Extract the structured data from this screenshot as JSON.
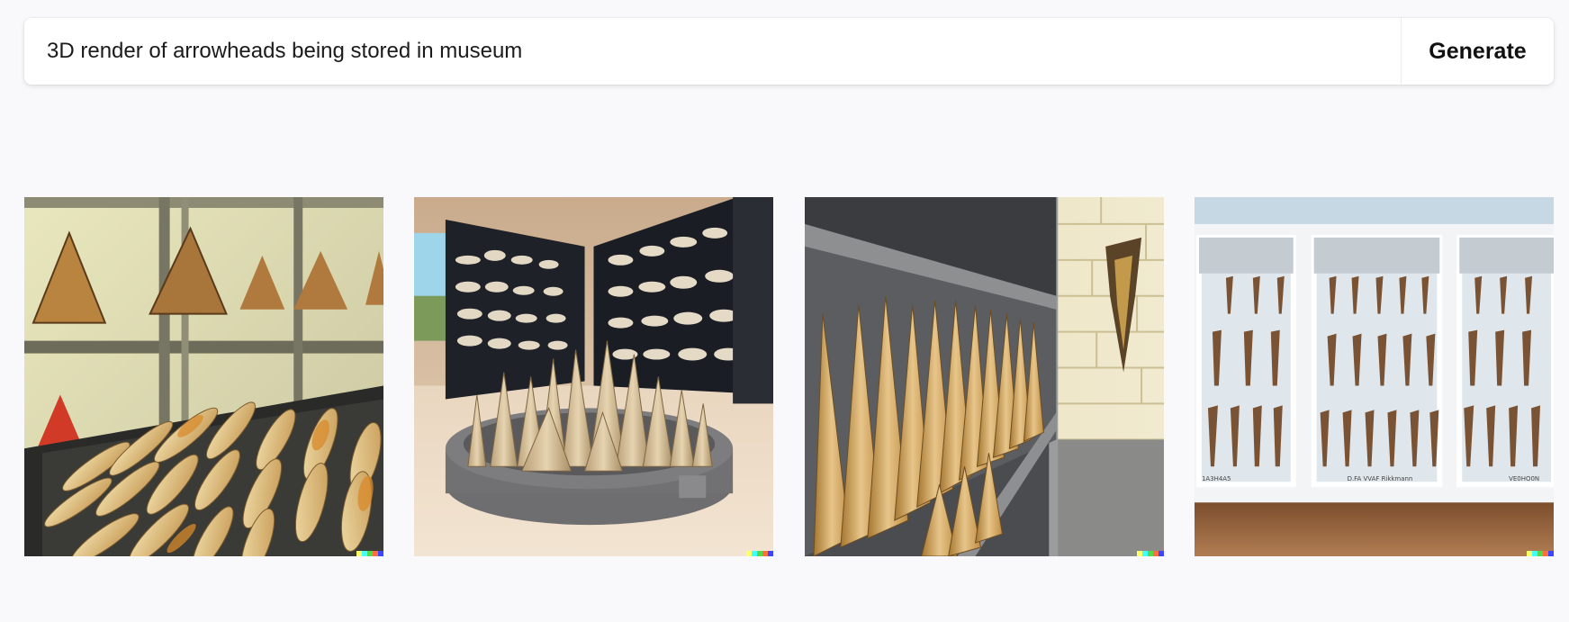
{
  "prompt": {
    "value": "3D render of arrowheads being stored in museum",
    "placeholder": ""
  },
  "toolbar": {
    "generate_label": "Generate"
  },
  "gallery": {
    "images": [
      {
        "subject": "tray of flint arrowheads in front of glass display walls"
      },
      {
        "subject": "round dish of arrowheads with dark shelving behind"
      },
      {
        "subject": "grey shelves lined with arrowheads beside a brick wall"
      },
      {
        "subject": "white display case with rows of small arrowheads",
        "case_labels": [
          "1A3H4A5",
          "D.FA VVAF Rikkmann",
          "VE0HO0N"
        ]
      }
    ],
    "signature_colors": [
      "#ffff66",
      "#42ffff",
      "#51da4c",
      "#ff6e3c",
      "#3c46ff"
    ]
  }
}
